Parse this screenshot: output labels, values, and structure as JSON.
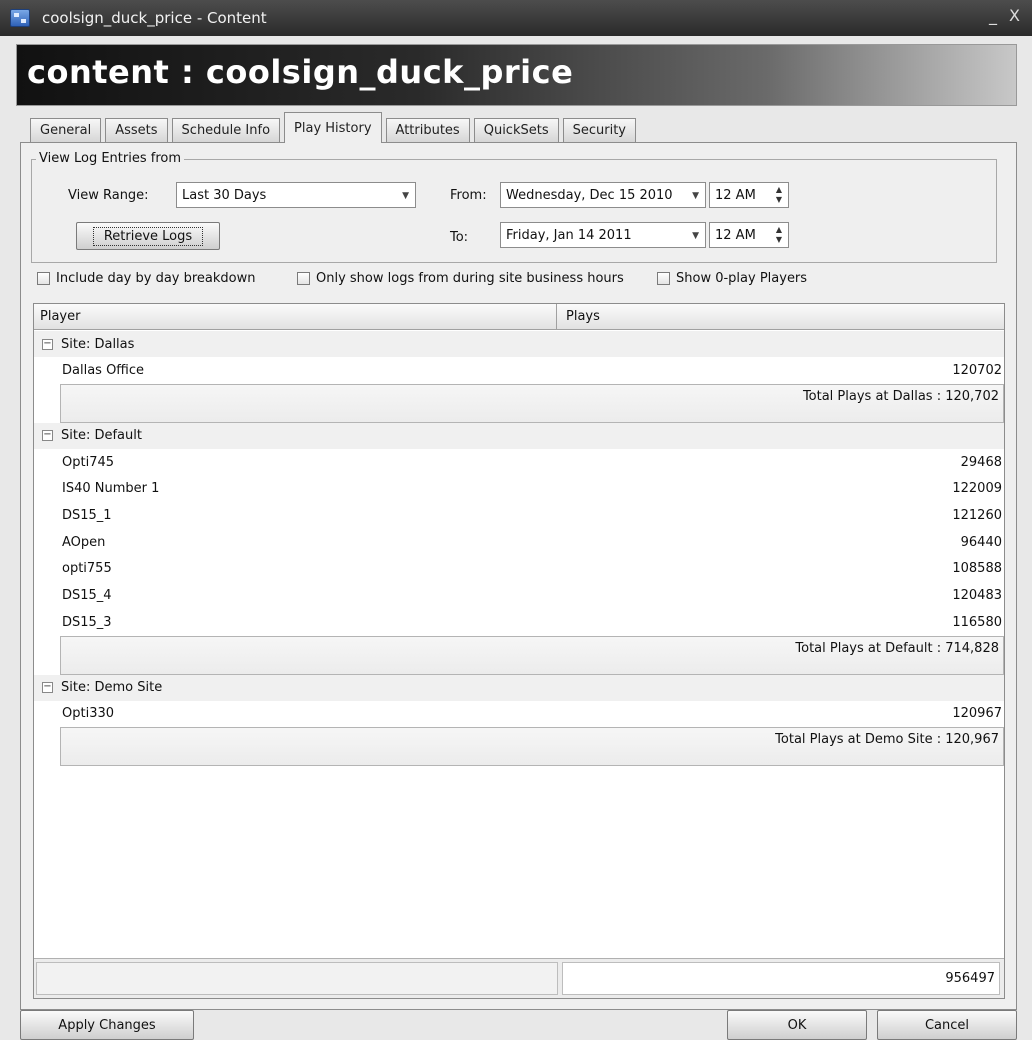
{
  "window": {
    "title": "coolsign_duck_price - Content",
    "minimize_glyph": "_",
    "close_glyph": "X"
  },
  "banner": {
    "title": "content : coolsign_duck_price"
  },
  "tabs": [
    {
      "label": "General"
    },
    {
      "label": "Assets"
    },
    {
      "label": "Schedule Info"
    },
    {
      "label": "Play History"
    },
    {
      "label": "Attributes"
    },
    {
      "label": "QuickSets"
    },
    {
      "label": "Security"
    }
  ],
  "active_tab": "Play History",
  "log_range": {
    "legend": "View Log Entries from",
    "view_range_label": "View Range:",
    "view_range_value": "Last 30 Days",
    "from_label": "From:",
    "from_date": "Wednesday, Dec 15 2010",
    "from_time": "12 AM",
    "to_label": "To:",
    "to_date": "Friday, Jan 14 2011",
    "to_time": "12 AM",
    "retrieve_button": "Retrieve Logs"
  },
  "options": {
    "day_by_day": {
      "label": "Include day by day breakdown",
      "checked": false
    },
    "business_hours": {
      "label": "Only show logs from during site business hours",
      "checked": false
    },
    "zero_play": {
      "label": "Show 0-play Players",
      "checked": false
    }
  },
  "grid": {
    "columns": [
      "Player",
      "Plays"
    ],
    "groups": [
      {
        "header": "Site: Dallas",
        "rows": [
          {
            "player": "Dallas Office",
            "plays": "120702"
          }
        ],
        "total": "Total Plays at Dallas : 120,702"
      },
      {
        "header": "Site: Default",
        "rows": [
          {
            "player": "Opti745",
            "plays": "29468"
          },
          {
            "player": "IS40 Number 1",
            "plays": "122009"
          },
          {
            "player": "DS15_1",
            "plays": "121260"
          },
          {
            "player": "AOpen",
            "plays": "96440"
          },
          {
            "player": "opti755",
            "plays": "108588"
          },
          {
            "player": "DS15_4",
            "plays": "120483"
          },
          {
            "player": "DS15_3",
            "plays": "116580"
          }
        ],
        "total": "Total Plays at Default : 714,828"
      },
      {
        "header": "Site: Demo Site",
        "rows": [
          {
            "player": "Opti330",
            "plays": "120967"
          }
        ],
        "total": "Total Plays at Demo Site : 120,967"
      }
    ],
    "grand_total": "956497"
  },
  "footer": {
    "apply_button": "Apply Changes",
    "ok_button": "OK",
    "cancel_button": "Cancel"
  }
}
